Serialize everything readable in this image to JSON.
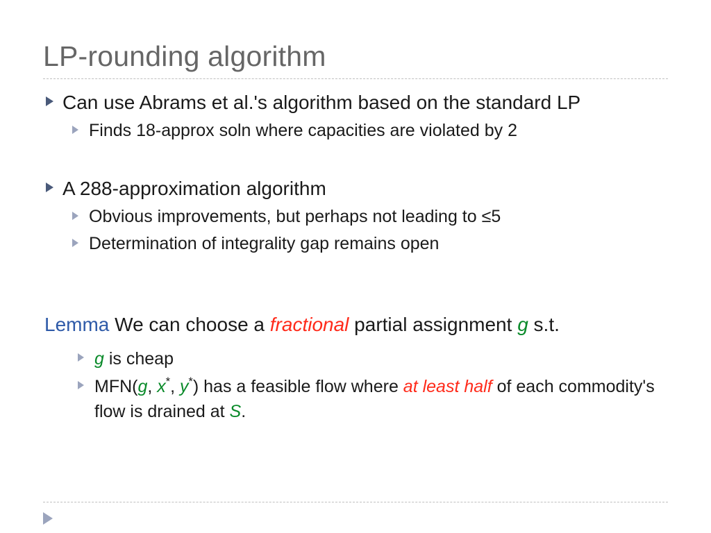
{
  "title": "LP-rounding algorithm",
  "b1": {
    "text": "Can use Abrams et al.'s algorithm based on the standard LP",
    "sub1": "Finds 18-approx soln where capacities are violated by 2"
  },
  "b2": {
    "text": "A 288-approximation algorithm",
    "sub1": "Obvious improvements, but perhaps not leading to ≤5",
    "sub2": "Determination of integrality gap remains open"
  },
  "lemma": {
    "label": "Lemma",
    "pre": " We can choose a ",
    "fractional": "fractional",
    "mid": " partial assignment ",
    "g": "g",
    "post": " s.t.",
    "sub1_g": "g",
    "sub1_rest": " is cheap",
    "sub2_pre": "MFN(",
    "sub2_g": "g",
    "sub2_c1": ", ",
    "sub2_x": "x",
    "sub2_star": "*",
    "sub2_c2": ", ",
    "sub2_y": "y",
    "sub2_mid": ") has a feasible flow where ",
    "sub2_red": "at least half",
    "sub2_post1": " of each commodity's flow is drained at ",
    "sub2_S": "S",
    "sub2_dot": "."
  }
}
